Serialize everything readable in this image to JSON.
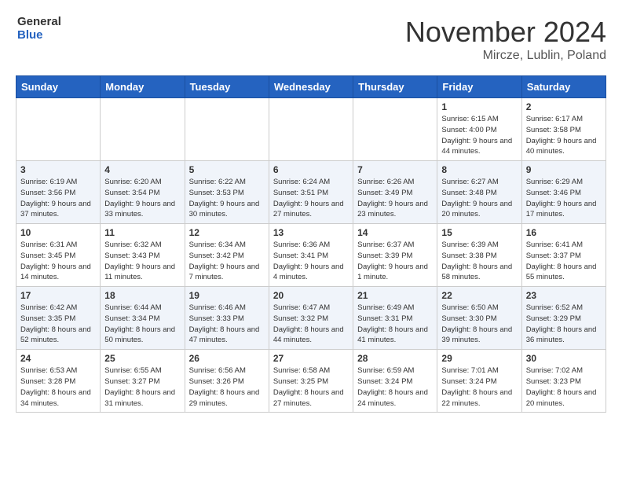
{
  "header": {
    "logo_line1": "General",
    "logo_line2": "Blue",
    "month_title": "November 2024",
    "location": "Mircze, Lublin, Poland"
  },
  "weekdays": [
    "Sunday",
    "Monday",
    "Tuesday",
    "Wednesday",
    "Thursday",
    "Friday",
    "Saturday"
  ],
  "weeks": [
    [
      {
        "day": "",
        "info": ""
      },
      {
        "day": "",
        "info": ""
      },
      {
        "day": "",
        "info": ""
      },
      {
        "day": "",
        "info": ""
      },
      {
        "day": "",
        "info": ""
      },
      {
        "day": "1",
        "info": "Sunrise: 6:15 AM\nSunset: 4:00 PM\nDaylight: 9 hours and 44 minutes."
      },
      {
        "day": "2",
        "info": "Sunrise: 6:17 AM\nSunset: 3:58 PM\nDaylight: 9 hours and 40 minutes."
      }
    ],
    [
      {
        "day": "3",
        "info": "Sunrise: 6:19 AM\nSunset: 3:56 PM\nDaylight: 9 hours and 37 minutes."
      },
      {
        "day": "4",
        "info": "Sunrise: 6:20 AM\nSunset: 3:54 PM\nDaylight: 9 hours and 33 minutes."
      },
      {
        "day": "5",
        "info": "Sunrise: 6:22 AM\nSunset: 3:53 PM\nDaylight: 9 hours and 30 minutes."
      },
      {
        "day": "6",
        "info": "Sunrise: 6:24 AM\nSunset: 3:51 PM\nDaylight: 9 hours and 27 minutes."
      },
      {
        "day": "7",
        "info": "Sunrise: 6:26 AM\nSunset: 3:49 PM\nDaylight: 9 hours and 23 minutes."
      },
      {
        "day": "8",
        "info": "Sunrise: 6:27 AM\nSunset: 3:48 PM\nDaylight: 9 hours and 20 minutes."
      },
      {
        "day": "9",
        "info": "Sunrise: 6:29 AM\nSunset: 3:46 PM\nDaylight: 9 hours and 17 minutes."
      }
    ],
    [
      {
        "day": "10",
        "info": "Sunrise: 6:31 AM\nSunset: 3:45 PM\nDaylight: 9 hours and 14 minutes."
      },
      {
        "day": "11",
        "info": "Sunrise: 6:32 AM\nSunset: 3:43 PM\nDaylight: 9 hours and 11 minutes."
      },
      {
        "day": "12",
        "info": "Sunrise: 6:34 AM\nSunset: 3:42 PM\nDaylight: 9 hours and 7 minutes."
      },
      {
        "day": "13",
        "info": "Sunrise: 6:36 AM\nSunset: 3:41 PM\nDaylight: 9 hours and 4 minutes."
      },
      {
        "day": "14",
        "info": "Sunrise: 6:37 AM\nSunset: 3:39 PM\nDaylight: 9 hours and 1 minute."
      },
      {
        "day": "15",
        "info": "Sunrise: 6:39 AM\nSunset: 3:38 PM\nDaylight: 8 hours and 58 minutes."
      },
      {
        "day": "16",
        "info": "Sunrise: 6:41 AM\nSunset: 3:37 PM\nDaylight: 8 hours and 55 minutes."
      }
    ],
    [
      {
        "day": "17",
        "info": "Sunrise: 6:42 AM\nSunset: 3:35 PM\nDaylight: 8 hours and 52 minutes."
      },
      {
        "day": "18",
        "info": "Sunrise: 6:44 AM\nSunset: 3:34 PM\nDaylight: 8 hours and 50 minutes."
      },
      {
        "day": "19",
        "info": "Sunrise: 6:46 AM\nSunset: 3:33 PM\nDaylight: 8 hours and 47 minutes."
      },
      {
        "day": "20",
        "info": "Sunrise: 6:47 AM\nSunset: 3:32 PM\nDaylight: 8 hours and 44 minutes."
      },
      {
        "day": "21",
        "info": "Sunrise: 6:49 AM\nSunset: 3:31 PM\nDaylight: 8 hours and 41 minutes."
      },
      {
        "day": "22",
        "info": "Sunrise: 6:50 AM\nSunset: 3:30 PM\nDaylight: 8 hours and 39 minutes."
      },
      {
        "day": "23",
        "info": "Sunrise: 6:52 AM\nSunset: 3:29 PM\nDaylight: 8 hours and 36 minutes."
      }
    ],
    [
      {
        "day": "24",
        "info": "Sunrise: 6:53 AM\nSunset: 3:28 PM\nDaylight: 8 hours and 34 minutes."
      },
      {
        "day": "25",
        "info": "Sunrise: 6:55 AM\nSunset: 3:27 PM\nDaylight: 8 hours and 31 minutes."
      },
      {
        "day": "26",
        "info": "Sunrise: 6:56 AM\nSunset: 3:26 PM\nDaylight: 8 hours and 29 minutes."
      },
      {
        "day": "27",
        "info": "Sunrise: 6:58 AM\nSunset: 3:25 PM\nDaylight: 8 hours and 27 minutes."
      },
      {
        "day": "28",
        "info": "Sunrise: 6:59 AM\nSunset: 3:24 PM\nDaylight: 8 hours and 24 minutes."
      },
      {
        "day": "29",
        "info": "Sunrise: 7:01 AM\nSunset: 3:24 PM\nDaylight: 8 hours and 22 minutes."
      },
      {
        "day": "30",
        "info": "Sunrise: 7:02 AM\nSunset: 3:23 PM\nDaylight: 8 hours and 20 minutes."
      }
    ]
  ]
}
